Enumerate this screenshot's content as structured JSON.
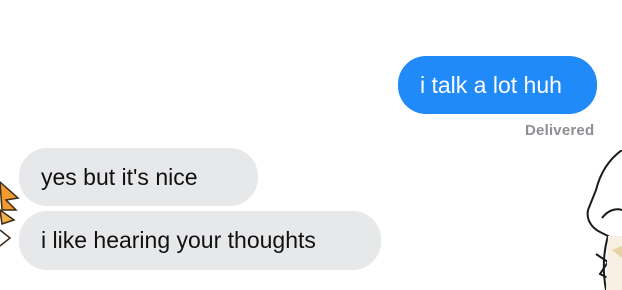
{
  "conversation": {
    "messages": [
      {
        "sender": "me",
        "text": "i talk a lot huh"
      },
      {
        "sender": "them",
        "text": "yes but it's nice"
      },
      {
        "sender": "them",
        "text": "i like hearing your thoughts"
      }
    ],
    "status": "Delivered"
  },
  "colors": {
    "sent_bubble": "#1f8af8",
    "received_bubble": "#e7e8ea",
    "status_text": "#8e8e93"
  },
  "icons": {
    "left_decoration": "anime-character-hair-icon",
    "right_decoration": "anime-character-arm-icon"
  }
}
